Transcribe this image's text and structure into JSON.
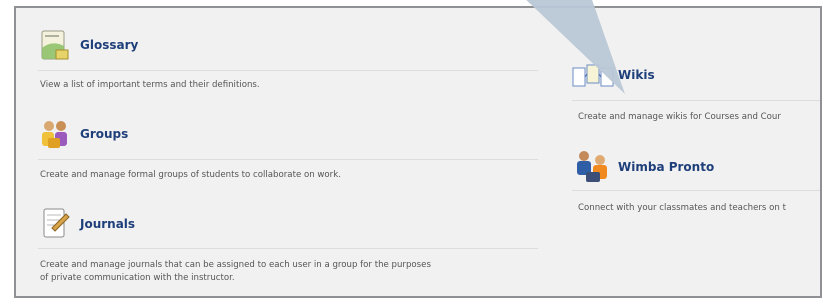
{
  "tools": {
    "glossary": {
      "title": "Glossary",
      "description": "View a list of important terms and their definitions."
    },
    "groups": {
      "title": "Groups",
      "description": "Create and manage formal groups of students to collaborate on work."
    },
    "journals": {
      "title": "Journals",
      "description_line1": "Create and manage journals that can be assigned to each user in a group for the purposes",
      "description_line2": "of private communication with the instructor."
    },
    "wikis": {
      "title": "Wikis",
      "description": "Create and manage wikis for Courses and Cour"
    },
    "wimba_pronto": {
      "title": "Wimba Pronto",
      "description": "Connect with your classmates and teachers on t"
    }
  }
}
